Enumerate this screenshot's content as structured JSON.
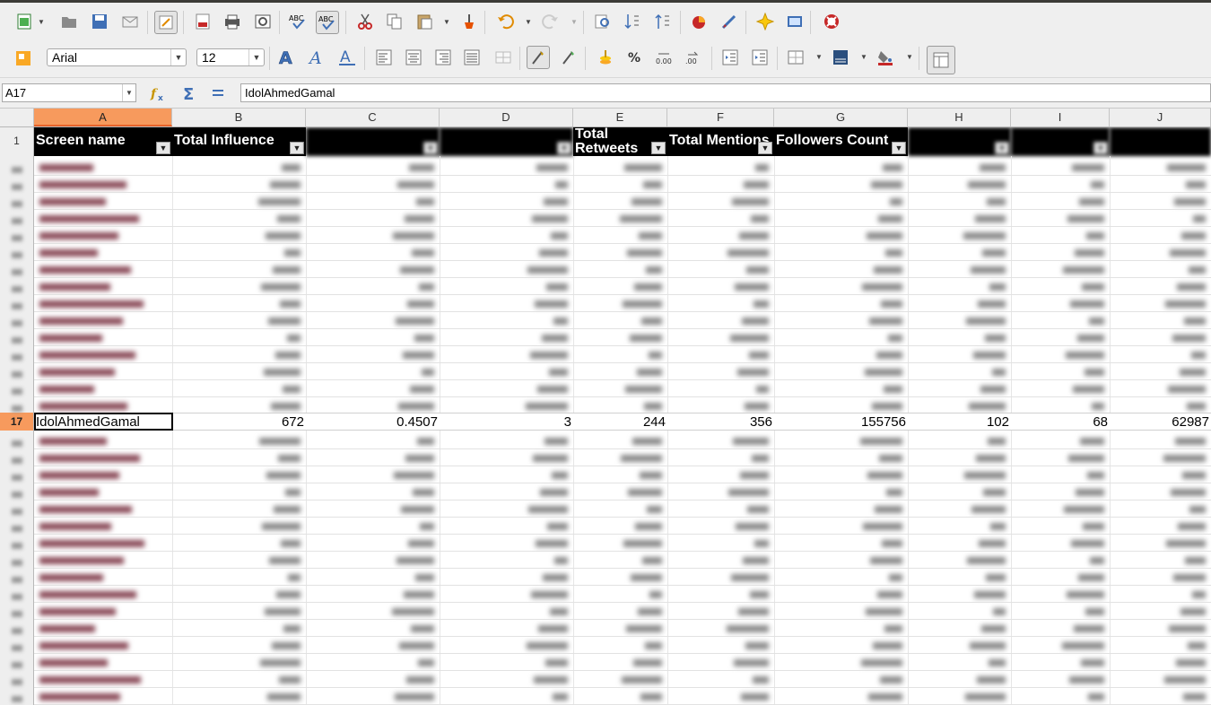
{
  "font": {
    "name": "Arial",
    "size": "12"
  },
  "formula_bar": {
    "cell_ref": "A17",
    "content": "IdolAhmedGamal"
  },
  "columns": [
    "A",
    "B",
    "C",
    "D",
    "E",
    "F",
    "G",
    "H",
    "I",
    "J"
  ],
  "selected_column": "A",
  "header_row": {
    "number": "1",
    "cells": {
      "A": "Screen name",
      "B": "Total Influence",
      "E": "Total Retweets",
      "F": "Total Mentions",
      "G": "Followers Count"
    }
  },
  "active_row": {
    "number": "17",
    "cells": {
      "A": "IdolAhmedGamal",
      "B": "672",
      "C": "0.4507",
      "D": "3",
      "E": "244",
      "F": "356",
      "G": "155756",
      "H": "102",
      "I": "68",
      "J": "62987"
    }
  },
  "colors": {
    "accent": "#f79a5d",
    "header_bg": "#000000",
    "toolbar_bg": "#efefef"
  }
}
